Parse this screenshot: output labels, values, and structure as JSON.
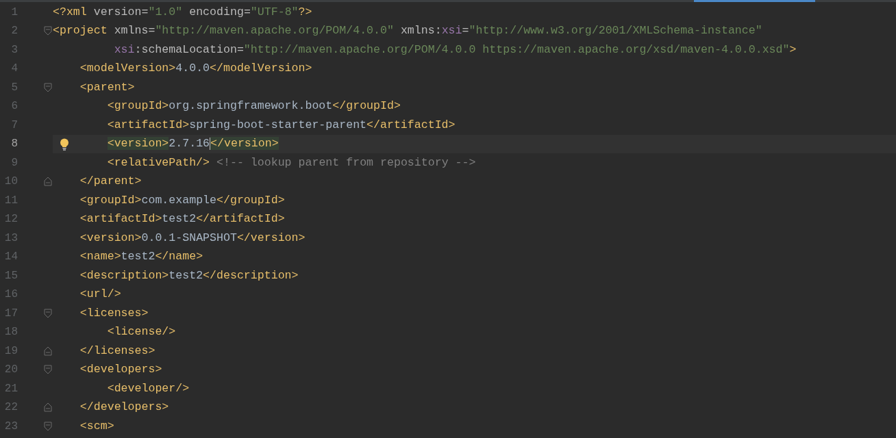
{
  "editor": {
    "lines": [
      {
        "number": "1",
        "current": false,
        "fold_start": false,
        "fold_end": false,
        "tokens": [
          {
            "kind": "tag",
            "text": "<?xml "
          },
          {
            "kind": "attr",
            "text": "version"
          },
          {
            "kind": "punct",
            "text": "="
          },
          {
            "kind": "value",
            "text": "\"1.0\""
          },
          {
            "kind": "attr",
            "text": " encoding"
          },
          {
            "kind": "punct",
            "text": "="
          },
          {
            "kind": "value",
            "text": "\"UTF-8\""
          },
          {
            "kind": "tag",
            "text": "?>"
          }
        ]
      },
      {
        "number": "2",
        "current": false,
        "fold_start": true,
        "fold_end": false,
        "tokens": [
          {
            "kind": "tag",
            "text": "<project "
          },
          {
            "kind": "attr",
            "text": "xmlns"
          },
          {
            "kind": "punct",
            "text": "="
          },
          {
            "kind": "value",
            "text": "\"http://maven.apache.org/POM/4.0.0\""
          },
          {
            "kind": "attr",
            "text": " xmlns:"
          },
          {
            "kind": "ns",
            "text": "xsi"
          },
          {
            "kind": "punct",
            "text": "="
          },
          {
            "kind": "value",
            "text": "\"http://www.w3.org/2001/XMLSchema-instance\""
          }
        ]
      },
      {
        "number": "3",
        "current": false,
        "fold_start": false,
        "fold_end": false,
        "tokens": [
          {
            "kind": "ns",
            "text": "         xsi"
          },
          {
            "kind": "attr",
            "text": ":schemaLocation"
          },
          {
            "kind": "punct",
            "text": "="
          },
          {
            "kind": "value",
            "text": "\"http://maven.apache.org/POM/4.0.0 https://maven.apache.org/xsd/maven-4.0.0.xsd\""
          },
          {
            "kind": "tag",
            "text": ">"
          }
        ]
      },
      {
        "number": "4",
        "current": false,
        "fold_start": false,
        "fold_end": false,
        "tokens": [
          {
            "kind": "tag",
            "text": "    <modelVersion>"
          },
          {
            "kind": "text",
            "text": "4.0.0"
          },
          {
            "kind": "tag",
            "text": "</modelVersion>"
          }
        ]
      },
      {
        "number": "5",
        "current": false,
        "fold_start": true,
        "fold_end": false,
        "tokens": [
          {
            "kind": "tag",
            "text": "    <parent>"
          }
        ]
      },
      {
        "number": "6",
        "current": false,
        "fold_start": false,
        "fold_end": false,
        "tokens": [
          {
            "kind": "tag",
            "text": "        <groupId>"
          },
          {
            "kind": "text",
            "text": "org.springframework.boot"
          },
          {
            "kind": "tag",
            "text": "</groupId>"
          }
        ]
      },
      {
        "number": "7",
        "current": false,
        "fold_start": false,
        "fold_end": false,
        "tokens": [
          {
            "kind": "tag",
            "text": "        <artifactId>"
          },
          {
            "kind": "text",
            "text": "spring-boot-starter-parent"
          },
          {
            "kind": "tag",
            "text": "</artifactId>"
          }
        ]
      },
      {
        "number": "8",
        "current": true,
        "fold_start": false,
        "fold_end": false,
        "tokens": [
          {
            "kind": "tag",
            "text": "        <version>",
            "match": true
          },
          {
            "kind": "text",
            "text": "2.7.16",
            "caret": true
          },
          {
            "kind": "tag",
            "text": "</version>",
            "match": true
          }
        ]
      },
      {
        "number": "9",
        "current": false,
        "fold_start": false,
        "fold_end": false,
        "tokens": [
          {
            "kind": "tag",
            "text": "        <relativePath/>"
          },
          {
            "kind": "comment",
            "text": " <!-- lookup parent from repository -->"
          }
        ]
      },
      {
        "number": "10",
        "current": false,
        "fold_start": false,
        "fold_end": true,
        "tokens": [
          {
            "kind": "tag",
            "text": "    </parent>"
          }
        ]
      },
      {
        "number": "11",
        "current": false,
        "fold_start": false,
        "fold_end": false,
        "tokens": [
          {
            "kind": "tag",
            "text": "    <groupId>"
          },
          {
            "kind": "text",
            "text": "com.example"
          },
          {
            "kind": "tag",
            "text": "</groupId>"
          }
        ]
      },
      {
        "number": "12",
        "current": false,
        "fold_start": false,
        "fold_end": false,
        "tokens": [
          {
            "kind": "tag",
            "text": "    <artifactId>"
          },
          {
            "kind": "text",
            "text": "test2"
          },
          {
            "kind": "tag",
            "text": "</artifactId>"
          }
        ]
      },
      {
        "number": "13",
        "current": false,
        "fold_start": false,
        "fold_end": false,
        "tokens": [
          {
            "kind": "tag",
            "text": "    <version>"
          },
          {
            "kind": "text",
            "text": "0.0.1-SNAPSHOT"
          },
          {
            "kind": "tag",
            "text": "</version>"
          }
        ]
      },
      {
        "number": "14",
        "current": false,
        "fold_start": false,
        "fold_end": false,
        "tokens": [
          {
            "kind": "tag",
            "text": "    <name>"
          },
          {
            "kind": "text",
            "text": "test2"
          },
          {
            "kind": "tag",
            "text": "</name>"
          }
        ]
      },
      {
        "number": "15",
        "current": false,
        "fold_start": false,
        "fold_end": false,
        "tokens": [
          {
            "kind": "tag",
            "text": "    <description>"
          },
          {
            "kind": "text",
            "text": "test2"
          },
          {
            "kind": "tag",
            "text": "</description>"
          }
        ]
      },
      {
        "number": "16",
        "current": false,
        "fold_start": false,
        "fold_end": false,
        "tokens": [
          {
            "kind": "tag",
            "text": "    <url/>"
          }
        ]
      },
      {
        "number": "17",
        "current": false,
        "fold_start": true,
        "fold_end": false,
        "tokens": [
          {
            "kind": "tag",
            "text": "    <licenses>"
          }
        ]
      },
      {
        "number": "18",
        "current": false,
        "fold_start": false,
        "fold_end": false,
        "tokens": [
          {
            "kind": "tag",
            "text": "        <license/>"
          }
        ]
      },
      {
        "number": "19",
        "current": false,
        "fold_start": false,
        "fold_end": true,
        "tokens": [
          {
            "kind": "tag",
            "text": "    </licenses>"
          }
        ]
      },
      {
        "number": "20",
        "current": false,
        "fold_start": true,
        "fold_end": false,
        "tokens": [
          {
            "kind": "tag",
            "text": "    <developers>"
          }
        ]
      },
      {
        "number": "21",
        "current": false,
        "fold_start": false,
        "fold_end": false,
        "tokens": [
          {
            "kind": "tag",
            "text": "        <developer/>"
          }
        ]
      },
      {
        "number": "22",
        "current": false,
        "fold_start": false,
        "fold_end": true,
        "tokens": [
          {
            "kind": "tag",
            "text": "    </developers>"
          }
        ]
      },
      {
        "number": "23",
        "current": false,
        "fold_start": true,
        "fold_end": false,
        "tokens": [
          {
            "kind": "tag",
            "text": "    <scm>"
          }
        ]
      }
    ]
  }
}
